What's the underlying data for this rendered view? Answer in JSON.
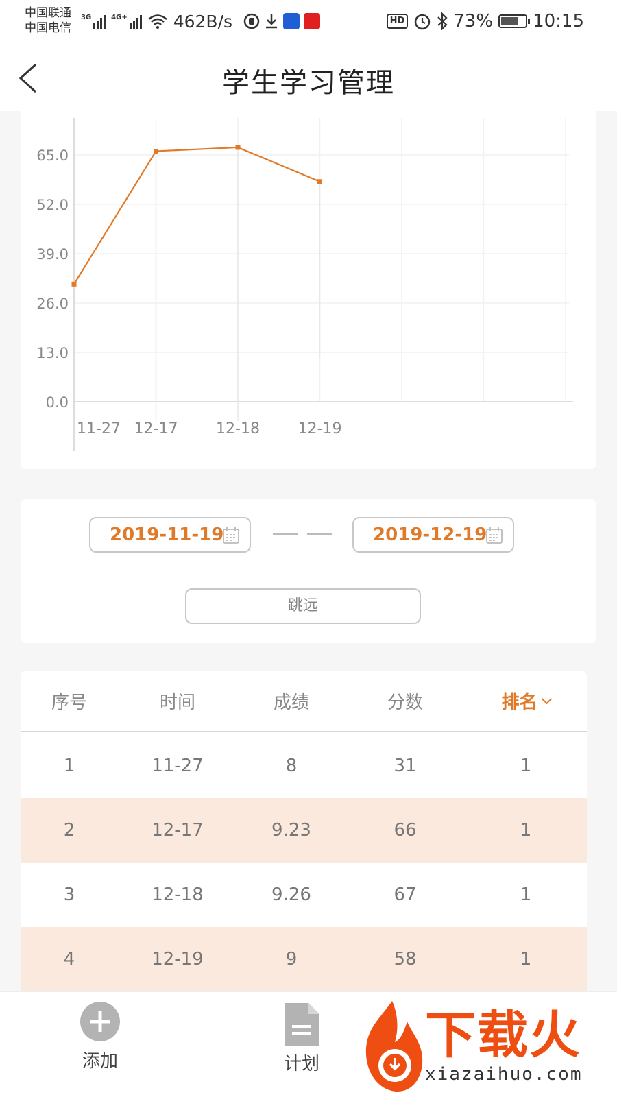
{
  "status_bar": {
    "carrier1": "中国联通",
    "carrier2": "中国电信",
    "net1": "3G",
    "net2": "4G+",
    "speed": "462B/s",
    "battery": "73%",
    "battery_level": 0.73,
    "time": "10:15",
    "hd_label": "HD",
    "app1_color": "#1f5fd6",
    "app2_color": "#e02020",
    "icons": [
      "shield-icon",
      "download-icon",
      "alarm-icon",
      "bluetooth-icon",
      "battery-icon",
      "wifi-icon"
    ]
  },
  "header": {
    "title": "学生学习管理",
    "back_icon": "chevron-left-icon"
  },
  "chart_data": {
    "type": "line",
    "categories": [
      "11-27",
      "12-17",
      "12-18",
      "12-19"
    ],
    "values": [
      31,
      66,
      67,
      58
    ],
    "yticks": [
      "0.0",
      "13.0",
      "26.0",
      "39.0",
      "52.0",
      "65.0"
    ],
    "ylim": [
      0,
      65
    ],
    "grid": true,
    "color": "#e07a28",
    "title": "",
    "xlabel": "",
    "ylabel": ""
  },
  "filter": {
    "start_date": "2019-11-19",
    "end_date": "2019-12-19",
    "event": "跳远",
    "accent": "#e07a28"
  },
  "table": {
    "headers": [
      "序号",
      "时间",
      "成绩",
      "分数",
      "排名"
    ],
    "sort_column": "排名",
    "rows": [
      [
        "1",
        "11-27",
        "8",
        "31",
        "1"
      ],
      [
        "2",
        "12-17",
        "9.23",
        "66",
        "1"
      ],
      [
        "3",
        "12-18",
        "9.26",
        "67",
        "1"
      ],
      [
        "4",
        "12-19",
        "9",
        "58",
        "1"
      ]
    ],
    "alt_row_color": "#fce9de"
  },
  "tabbar": {
    "add_label": "添加",
    "plan_label": "计划"
  },
  "watermark": {
    "text": "下载火",
    "url": "xiazaihuo.com"
  }
}
